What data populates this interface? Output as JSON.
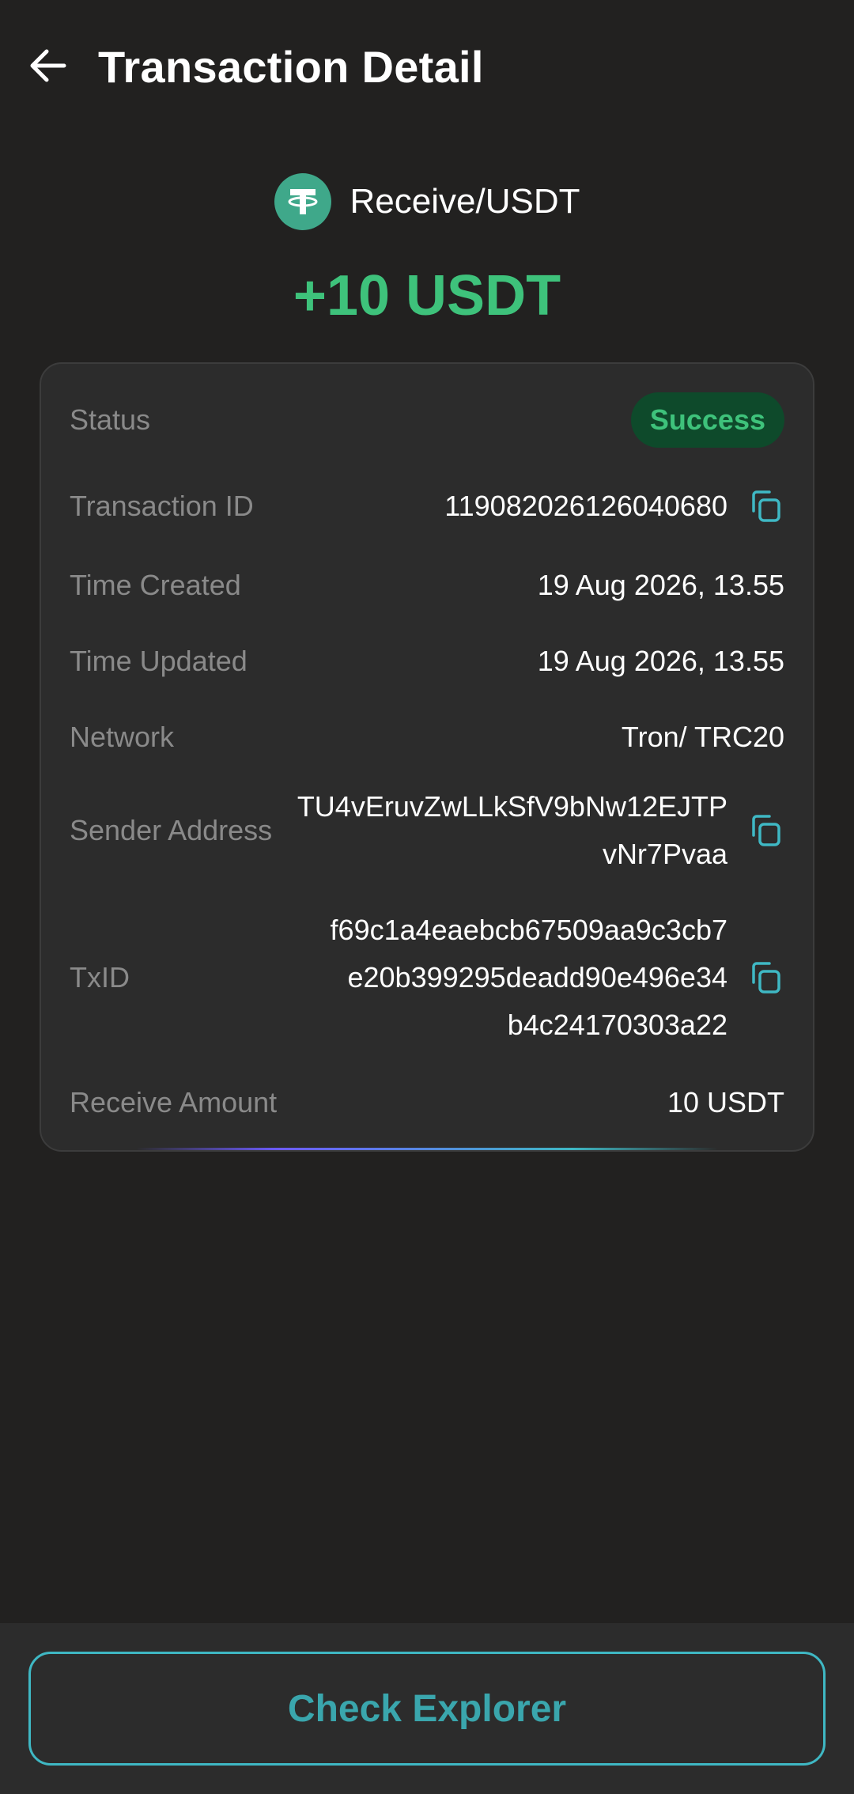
{
  "header": {
    "title": "Transaction Detail",
    "back_icon": "arrow-left-icon"
  },
  "asset": {
    "icon": "tether-usdt-icon",
    "label": "Receive/USDT"
  },
  "amount": "+10 USDT",
  "colors": {
    "accent_green": "#3ec27b",
    "accent_teal": "#3fb8c4",
    "background": "#222120",
    "card": "#2c2c2c"
  },
  "details": {
    "status": {
      "label": "Status",
      "value": "Success"
    },
    "transaction_id": {
      "label": "Transaction ID",
      "value": "119082026126040680",
      "copy_icon": "copy-icon"
    },
    "time_created": {
      "label": "Time Created",
      "value": "19 Aug 2026, 13.55"
    },
    "time_updated": {
      "label": "Time Updated",
      "value": "19 Aug 2026, 13.55"
    },
    "network": {
      "label": "Network",
      "value": "Tron/ TRC20"
    },
    "sender_address": {
      "label": "Sender Address",
      "lines": [
        "TU4vEruvZwLLkSfV9bNw12EJTP",
        "vNr7Pvaa"
      ],
      "copy_icon": "copy-icon"
    },
    "txid": {
      "label": "TxID",
      "lines": [
        "f69c1a4eaebcb67509aa9c3cb7",
        "e20b399295deadd90e496e34",
        "b4c24170303a22"
      ],
      "copy_icon": "copy-icon"
    },
    "receive_amount": {
      "label": "Receive Amount",
      "value": "10 USDT"
    }
  },
  "footer": {
    "explorer_button": "Check Explorer"
  }
}
